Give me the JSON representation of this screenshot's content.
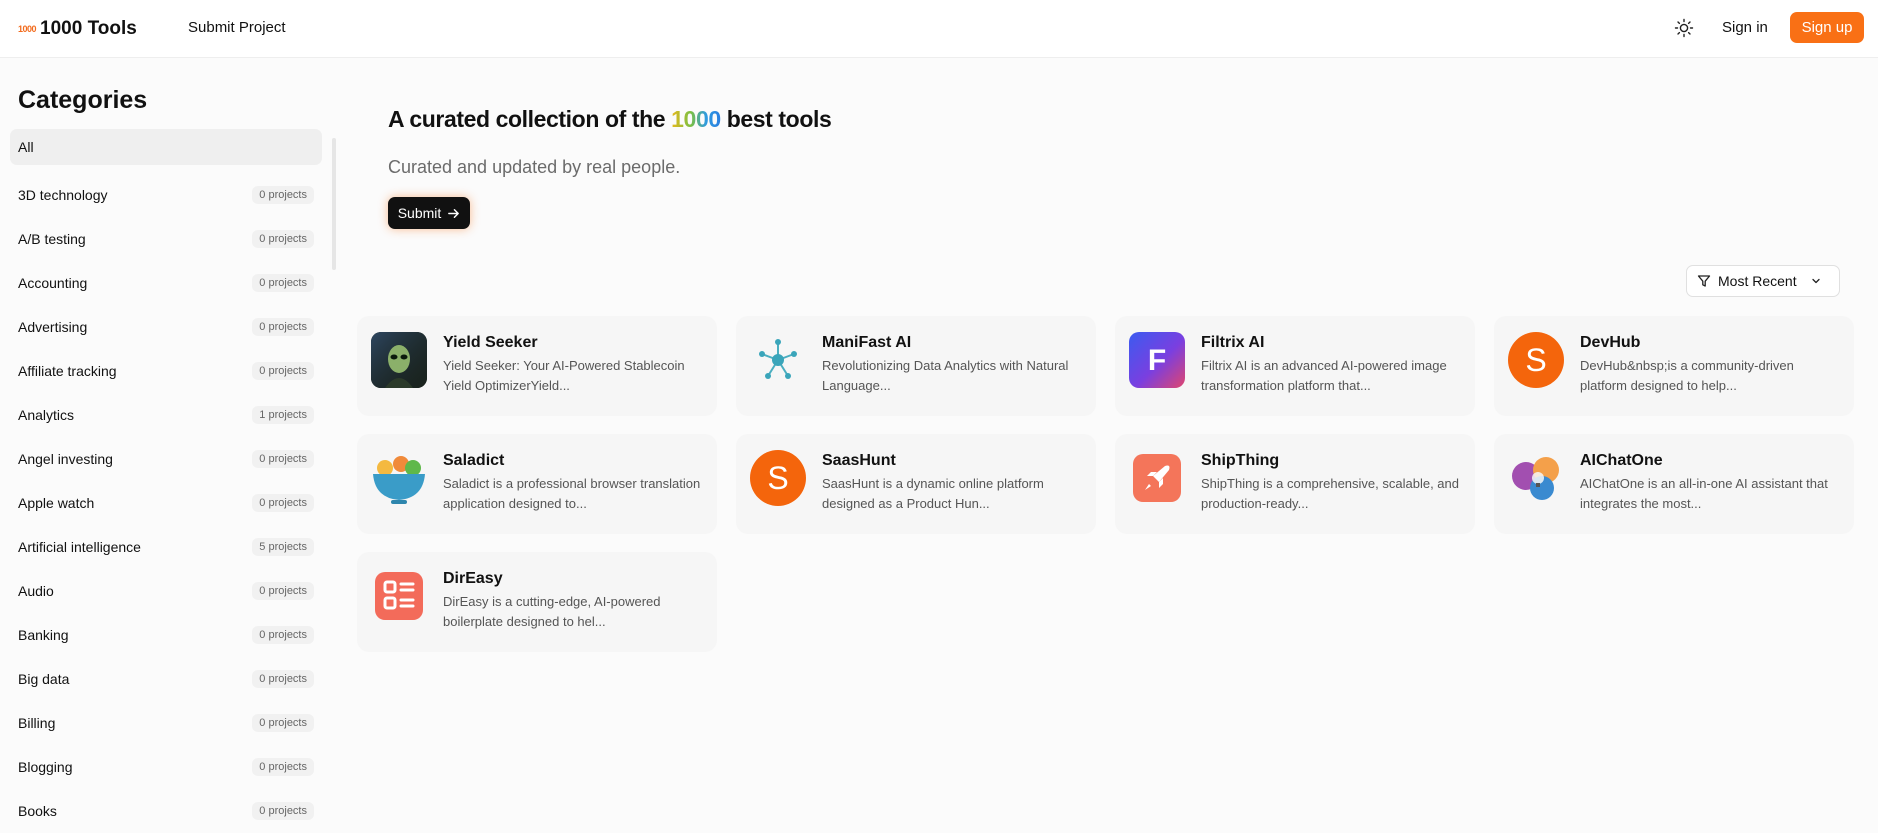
{
  "header": {
    "logo_mark": "1000",
    "logo_text": "1000 Tools",
    "submit_project": "Submit Project",
    "theme_icon": "sun-icon",
    "sign_in": "Sign in",
    "sign_up": "Sign up",
    "accent_color": "#f97015"
  },
  "sidebar": {
    "title": "Categories",
    "items": [
      {
        "label": "All",
        "count": ""
      },
      {
        "label": "3D technology",
        "count": "0 projects"
      },
      {
        "label": "A/B testing",
        "count": "0 projects"
      },
      {
        "label": "Accounting",
        "count": "0 projects"
      },
      {
        "label": "Advertising",
        "count": "0 projects"
      },
      {
        "label": "Affiliate tracking",
        "count": "0 projects"
      },
      {
        "label": "Analytics",
        "count": "1 projects"
      },
      {
        "label": "Angel investing",
        "count": "0 projects"
      },
      {
        "label": "Apple watch",
        "count": "0 projects"
      },
      {
        "label": "Artificial intelligence",
        "count": "5 projects"
      },
      {
        "label": "Audio",
        "count": "0 projects"
      },
      {
        "label": "Banking",
        "count": "0 projects"
      },
      {
        "label": "Big data",
        "count": "0 projects"
      },
      {
        "label": "Billing",
        "count": "0 projects"
      },
      {
        "label": "Blogging",
        "count": "0 projects"
      },
      {
        "label": "Books",
        "count": "0 projects"
      }
    ]
  },
  "hero": {
    "title_before": "A curated collection of the ",
    "title_number": "1000",
    "title_after": " best tools",
    "subtitle": "Curated and updated by real people.",
    "submit": "Submit"
  },
  "sort": {
    "label": "Most Recent"
  },
  "tools": [
    {
      "name": "Yield Seeker",
      "desc": "Yield Seeker: Your AI-Powered Stablecoin Yield OptimizerYield...",
      "icon": "alien-avatar-icon"
    },
    {
      "name": "ManiFast AI",
      "desc": "Revolutionizing Data Analytics with Natural Language...",
      "icon": "network-node-icon"
    },
    {
      "name": "Filtrix AI",
      "desc": "Filtrix AI is an advanced AI-powered image transformation platform that...",
      "icon": "letter-f-icon"
    },
    {
      "name": "DevHub",
      "desc": "DevHub&nbsp;is a community-driven platform designed to help...",
      "icon": "letter-s-icon"
    },
    {
      "name": "Saladict",
      "desc": "Saladict is a professional browser translation application designed to...",
      "icon": "salad-bowl-icon"
    },
    {
      "name": "SaasHunt",
      "desc": "SaasHunt is a dynamic online platform designed as a Product Hun...",
      "icon": "letter-s-icon"
    },
    {
      "name": "ShipThing",
      "desc": "ShipThing is a comprehensive, scalable, and production-ready...",
      "icon": "rocket-icon"
    },
    {
      "name": "AIChatOne",
      "desc": "AIChatOne is an all-in-one AI assistant that integrates the most...",
      "icon": "lightbulb-bubbles-icon"
    },
    {
      "name": "DirEasy",
      "desc": "DirEasy is a cutting-edge, AI-powered boilerplate designed to hel...",
      "icon": "list-document-icon"
    }
  ]
}
